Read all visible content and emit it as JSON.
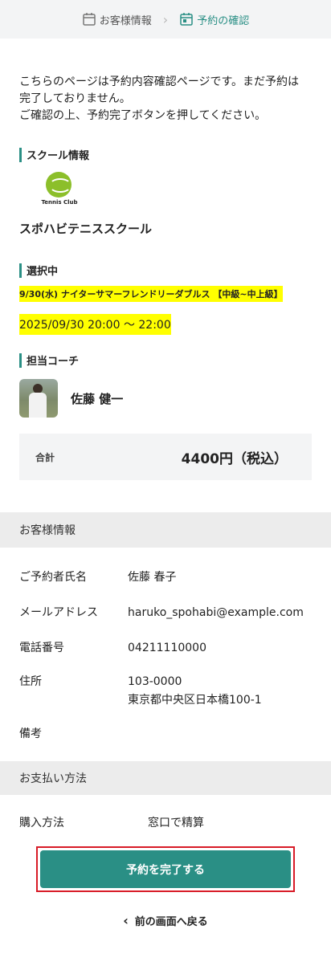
{
  "stepper": {
    "step1": "お客様情報",
    "step2": "予約の確認"
  },
  "intro": {
    "line1": "こちらのページは予約内容確認ページです。まだ予約は",
    "line2": "完了しておりません。",
    "line3": "ご確認の上、予約完了ボタンを押してください。"
  },
  "school": {
    "heading": "スクール情報",
    "logo_text": "Tennis Club",
    "name": "スポハビテニススクール"
  },
  "selection": {
    "heading": "選択中",
    "lesson": "9/30(水) ナイターサマーフレンドリーダブルス 【中級~中上級】",
    "datetime": "2025/09/30 20:00 〜 22:00"
  },
  "coach": {
    "heading": "担当コーチ",
    "name": "佐藤 健一"
  },
  "total": {
    "label": "合計",
    "value": "4400円（税込）"
  },
  "customer": {
    "heading": "お客様情報",
    "name_label": "ご予約者氏名",
    "name_value": "佐藤 春子",
    "email_label": "メールアドレス",
    "email_value": "haruko_spohabi@example.com",
    "phone_label": "電話番号",
    "phone_value": "04211110000",
    "address_label": "住所",
    "address_zip": "103-0000",
    "address_line": "東京都中央区日本橋100-1",
    "notes_label": "備考"
  },
  "payment": {
    "heading": "お支払い方法",
    "method_label": "購入方法",
    "method_value": "窓口で精算"
  },
  "actions": {
    "complete_label": "予約を完了する",
    "back_label": "前の画面へ戻る"
  },
  "colors": {
    "accent": "#2a8f85",
    "highlight": "#ffff00",
    "focus_border": "#d81b27"
  }
}
